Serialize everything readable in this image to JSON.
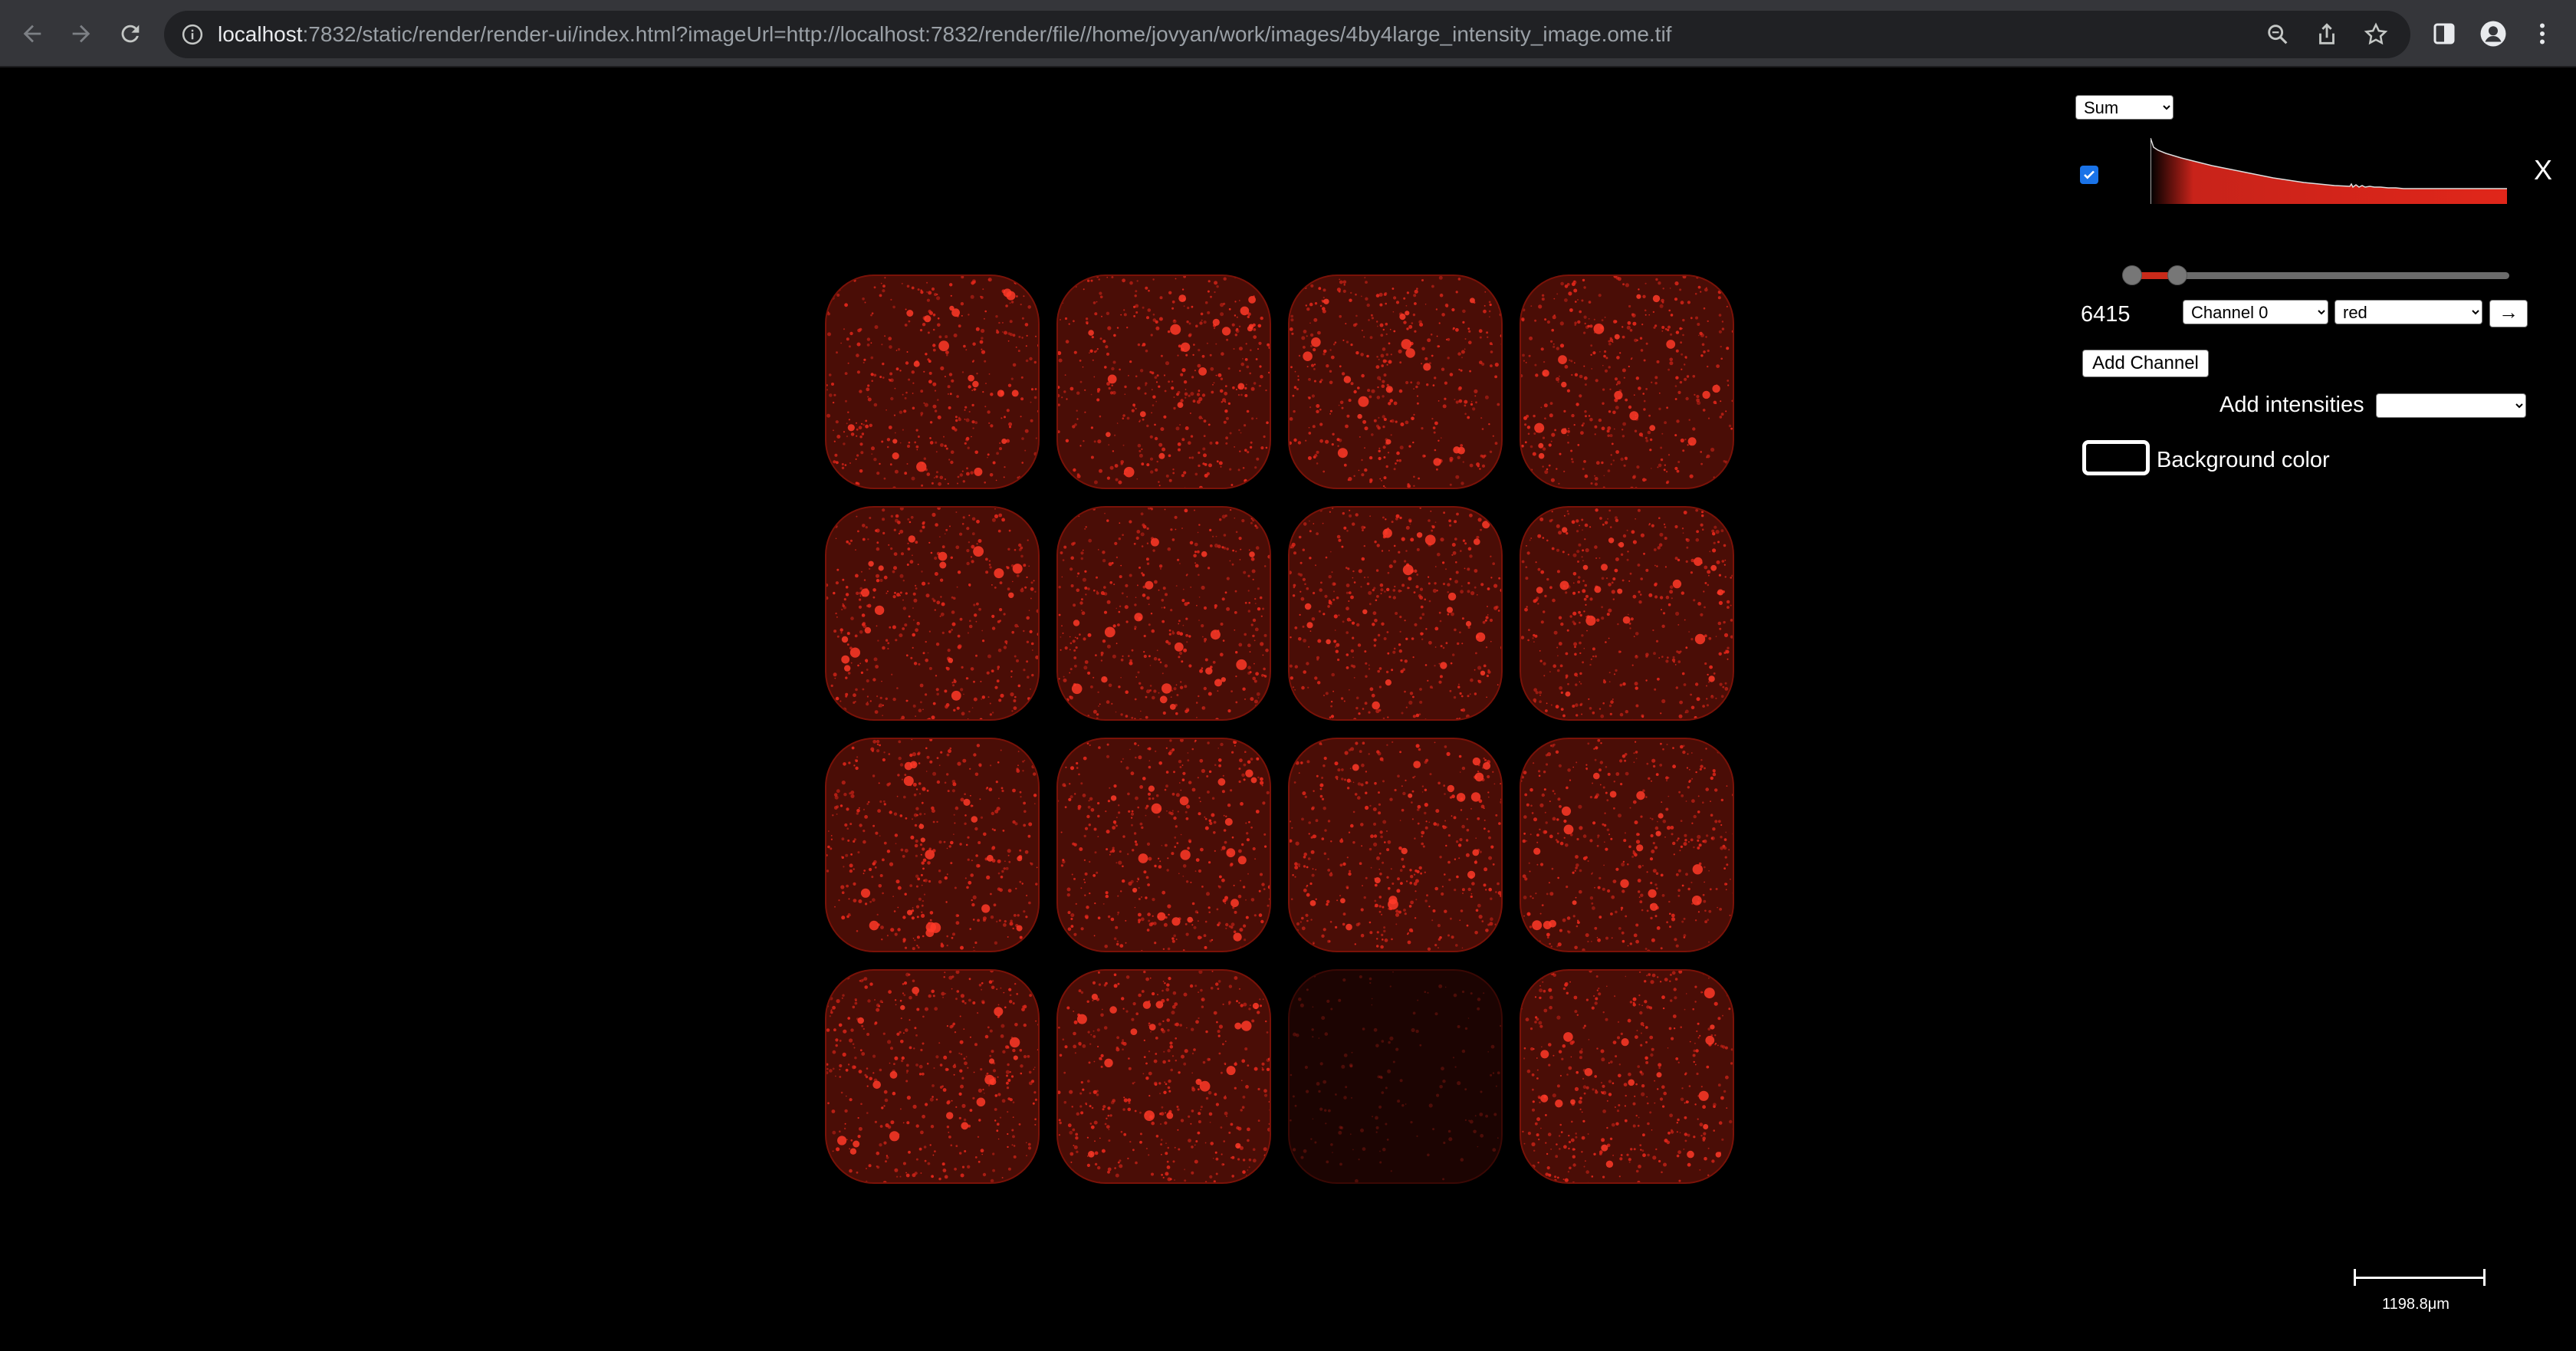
{
  "browser": {
    "url_host": "localhost",
    "url_rest": ":7832/static/render/render-ui/index.html?imageUrl=http://localhost:7832/render/file//home/jovyan/work/images/4by4large_intensity_image.ome.tif",
    "icons": [
      "back-icon",
      "forward-icon",
      "reload-icon",
      "info-icon",
      "zoom-icon",
      "share-icon",
      "star-icon",
      "sidebar-icon",
      "profile-icon",
      "menu-icon"
    ]
  },
  "viewer": {
    "grid_rows": 4,
    "grid_cols": 4,
    "dim_tile": {
      "row": 3,
      "col": 2
    },
    "tile_color": "#e0261a"
  },
  "panel": {
    "aggregate_select": {
      "value": "Sum",
      "options": [
        "Sum"
      ]
    },
    "channel_checked": true,
    "close_label": "X",
    "slider": {
      "min_fraction": 0.0,
      "max_fraction": 0.12
    },
    "value": "6415",
    "channel_select": {
      "value": "Channel 0"
    },
    "color_select": {
      "value": "red"
    },
    "apply_label": "→",
    "add_channel_label": "Add Channel",
    "add_intensities_label": "Add intensities",
    "add_intensities_select": {
      "value": ""
    },
    "background_label": "Background color",
    "background_color": "#000000"
  },
  "scale": {
    "label": "1198.8μm"
  },
  "colors": {
    "accent_red": "#e0261a",
    "checkbox_blue": "#1a73e8"
  }
}
